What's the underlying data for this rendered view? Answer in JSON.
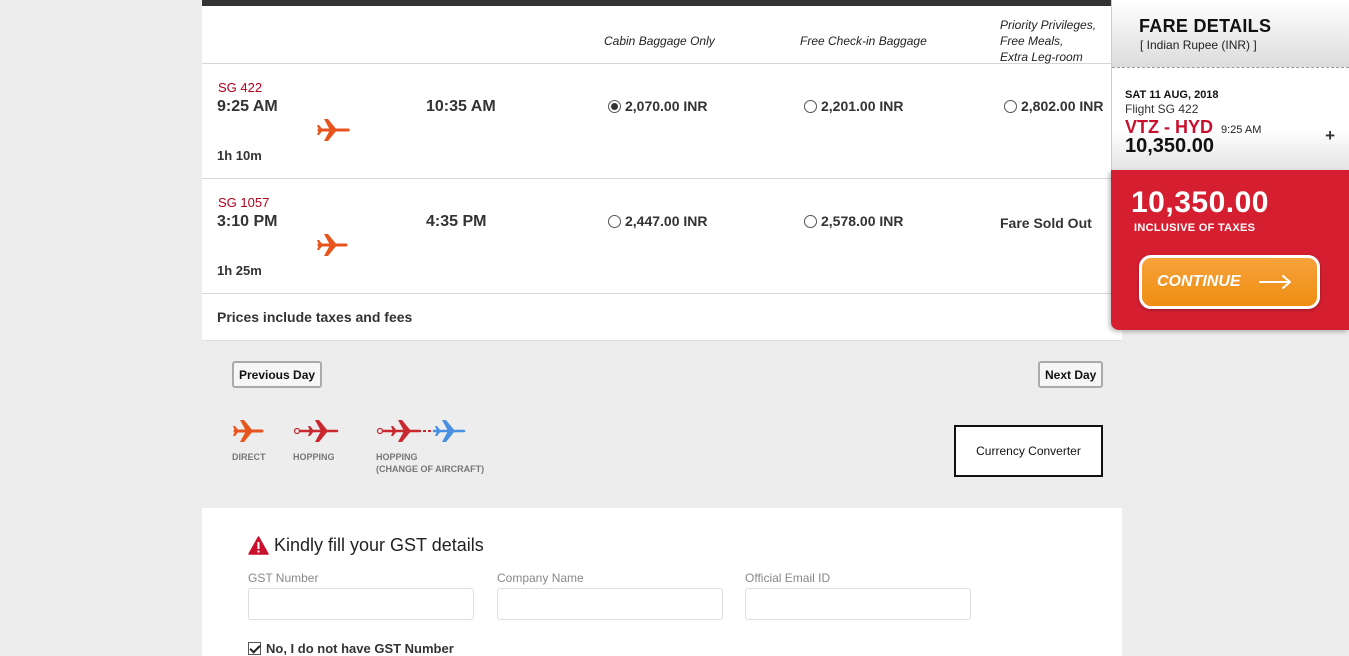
{
  "columns": {
    "cabin": "Cabin Baggage Only",
    "checkin": "Free Check-in Baggage",
    "priority": [
      "Priority Privileges,",
      "Free Meals,",
      "Extra Leg-room"
    ]
  },
  "flights": [
    {
      "flight_no": "SG 422",
      "depart": "9:25 AM",
      "arrive": "10:35 AM",
      "duration": "1h 10m",
      "fares": [
        {
          "label": "2,070.00 INR",
          "selected": true
        },
        {
          "label": "2,201.00 INR",
          "selected": false
        },
        {
          "label": "2,802.00 INR",
          "selected": false
        }
      ]
    },
    {
      "flight_no": "SG 1057",
      "depart": "3:10 PM",
      "arrive": "4:35 PM",
      "duration": "1h 25m",
      "fares": [
        {
          "label": "2,447.00 INR",
          "selected": false
        },
        {
          "label": "2,578.00 INR",
          "selected": false
        },
        {
          "label": "Fare Sold Out",
          "sold_out": true
        }
      ]
    }
  ],
  "note": "Prices include taxes and fees",
  "nav": {
    "prev": "Previous Day",
    "next": "Next Day"
  },
  "legend": {
    "direct": "DIRECT",
    "hopping": "HOPPING",
    "change_line1": "HOPPING",
    "change_line2": "(CHANGE OF AIRCRAFT)"
  },
  "currency_converter": "Currency Converter",
  "gst": {
    "title": "Kindly fill your GST details",
    "gst_number": "GST Number",
    "company_name": "Company Name",
    "email": "Official Email ID",
    "no_gst": "No, I do not have GST Number"
  },
  "fare_panel": {
    "title": "FARE DETAILS",
    "currency": "[ Indian Rupee (INR) ]",
    "date": "SAT 11 AUG, 2018",
    "flight": "Flight SG 422",
    "route": "VTZ - HYD",
    "time": "9:25 AM",
    "amount": "10,350.00",
    "plus": "+",
    "total": "10,350.00",
    "total_label": "INCLUSIVE OF TAXES",
    "continue": "CONTINUE"
  },
  "colors": {
    "brand_red": "#d51f31",
    "flight_red": "#b3001b",
    "continue_orange": "#ef8d12",
    "plane_orange": "#e8541e",
    "plane_blue": "#4a90e2"
  }
}
